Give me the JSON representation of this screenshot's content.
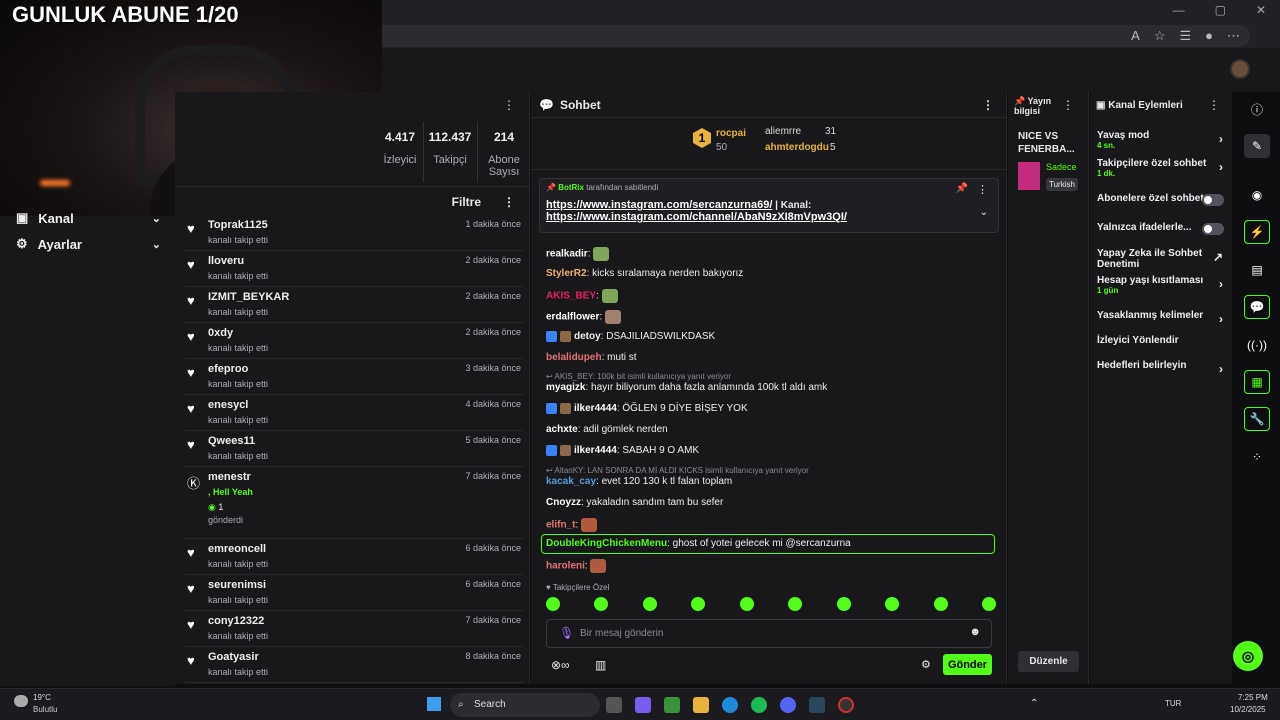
{
  "webcam": {
    "overlay_title": "GUNLUK ABUNE 1/20"
  },
  "sidebar": {
    "items": [
      {
        "label": "Kanal"
      },
      {
        "label": "Ayarlar"
      }
    ]
  },
  "stats": [
    {
      "value": "4.417",
      "label": "İzleyici"
    },
    {
      "value": "112.437",
      "label": "Takipçi"
    },
    {
      "value": "214",
      "label": "Abone Sayısı"
    }
  ],
  "activity": {
    "filter_label": "Filtre",
    "rows": [
      {
        "name": "Toprak1125",
        "sub": "kanalı takip etti",
        "time": "1 dakika önce"
      },
      {
        "name": "lloveru",
        "sub": "kanalı takip etti",
        "time": "2 dakika önce"
      },
      {
        "name": "IZMIT_BEYKAR",
        "sub": "kanalı takip etti",
        "time": "2 dakika önce"
      },
      {
        "name": "0xdy",
        "sub": "kanalı takip etti",
        "time": "2 dakika önce"
      },
      {
        "name": "efeproo",
        "sub": "kanalı takip etti",
        "time": "3 dakika önce"
      },
      {
        "name": "enesycl",
        "sub": "kanalı takip etti",
        "time": "4 dakika önce"
      },
      {
        "name": "Qwees11",
        "sub": "kanalı takip etti",
        "time": "5 dakika önce"
      },
      {
        "name": "emreoncell",
        "sub": "kanalı takip etti",
        "time": "6 dakika önce"
      },
      {
        "name": "seurenimsi",
        "sub": "kanalı takip etti",
        "time": "6 dakika önce"
      },
      {
        "name": "cony12322",
        "sub": "kanalı takip etti",
        "time": "7 dakika önce"
      },
      {
        "name": "Goatyasir",
        "sub": "kanalı takip etti",
        "time": "8 dakika önce"
      }
    ],
    "gift_row": {
      "name": "menestr",
      "message": ", Hell Yeah",
      "count": "1",
      "sub": "gönderdi",
      "time": "7 dakika önce"
    }
  },
  "chat": {
    "title": "Sohbet",
    "leaderboard": {
      "first": {
        "name": "rocpai",
        "value": "50",
        "rank": "1"
      },
      "second": {
        "name": "aliemrre",
        "value": "31"
      },
      "third": {
        "name": "ahmterdogdu",
        "value": "5"
      }
    },
    "pinned": {
      "by_user": "BotRix",
      "by_text": "tarafından sabitlendi",
      "link1": "https://www.instagram.com/sercanzurna69/",
      "sep": " | Kanal:",
      "link2": "https://www.instagram.com/channel/AbaN9zXI8mVpw3QI/"
    },
    "messages": [
      {
        "user": "realkadir",
        "text": "",
        "color": "#ffffff"
      },
      {
        "user": "StylerR2",
        "text": " kicks sıralamaya nerden bakıyorız",
        "color": "#f0b27a"
      },
      {
        "user": "AKIS_BEY",
        "text": "",
        "color": "#e91e63"
      },
      {
        "user": "erdalflower",
        "text": "",
        "color": "#ffffff"
      },
      {
        "user": "detoy",
        "text": " DSAJILIADSWILKDASK",
        "color": "#efeff1"
      },
      {
        "user": "belalidupeh",
        "text": " muti st",
        "color": "#e57373"
      },
      {
        "user": "myagizk",
        "text": " hayır biliyorum daha fazla anlamında 100k tl aldı amk",
        "color": "#ffffff"
      },
      {
        "user": "ilker4444",
        "text": " ÖĞLEN 9 DİYE BİŞEY YOK",
        "color": "#ffffff"
      },
      {
        "user": "achxte",
        "text": " adil gömlek nerden",
        "color": "#ffffff"
      },
      {
        "user": "ilker4444",
        "text": " SABAH 9 O AMK",
        "color": "#ffffff"
      },
      {
        "user": "kacak_cay",
        "text": " evet 120 130 k tl falan toplam",
        "color": "#5b9bd5"
      },
      {
        "user": "Cnoyzz",
        "text": " yakaladın sandım tam bu sefer",
        "color": "#ffffff"
      },
      {
        "user": "elifn_t",
        "text": "",
        "color": "#e57373"
      },
      {
        "user": "DoubleKingChickenMenu",
        "text": " ghost of yotei gelecek mi @sercanzurna",
        "color": "#53fc18"
      },
      {
        "user": "haroleni",
        "text": "",
        "color": "#e57373"
      }
    ],
    "replies": [
      "AKIS_BEY: 100k bit isimli kullanıcıya yanıt veriyor",
      "AltanKY: LAN SONRA DA Mİ ALDI KICKS isimli kullanıcıya yanıt veriyor"
    ],
    "followers_only": "Takipçilere Özel",
    "input_placeholder": "Bir mesaj gönderin",
    "send_label": "Gönder"
  },
  "stream_info": {
    "title": "Yayın bilgisi",
    "stream_title": "NICE VS FENERBA...",
    "thumb_label": "Sadece",
    "category": "Turkish"
  },
  "stream_edit_label": "Düzenle",
  "actions": {
    "title": "Kanal Eylemleri",
    "items": [
      {
        "label": "Yavaş mod",
        "value": "4 sn."
      },
      {
        "label": "Takipçilere özel sohbet",
        "value": "1 dk."
      },
      {
        "label": "Abonelere özel sohbet",
        "value": ""
      },
      {
        "label": "Yalnızca ifadelerle...",
        "value": ""
      },
      {
        "label": "Yapay Zeka ile Sohbet Denetimi",
        "value": ""
      },
      {
        "label": "Hesap yaşı kısıtlaması",
        "value": "1 gün"
      },
      {
        "label": "Yasaklanmış kelimeler",
        "value": ""
      },
      {
        "label": "İzleyici Yönlendir",
        "value": ""
      },
      {
        "label": "Hedefleri belirleyin",
        "value": ""
      }
    ]
  },
  "taskbar": {
    "weather_temp": "19°C",
    "weather_desc": "Bulutlu",
    "search": "Search",
    "lang": "TUR",
    "time": "7:25 PM",
    "date": "10/2/2025"
  },
  "colors": {
    "accent": "#53fc18",
    "bg": "#18181b"
  }
}
